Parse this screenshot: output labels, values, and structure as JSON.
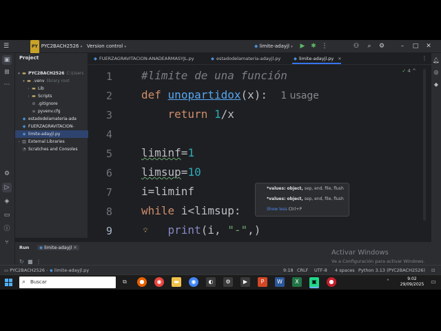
{
  "titlebar": {
    "project_badge": "PY",
    "project_name": "PYC2BACH2526",
    "vcs": "Version control",
    "run_config": "limite-adayjl"
  },
  "project_panel": {
    "title": "Project",
    "rows": [
      {
        "label": "PYC2BACH2526",
        "extra": "C:\\Users",
        "kind": "folder",
        "indent": 0,
        "expanded": true
      },
      {
        "label": ".venv",
        "extra": "library root",
        "kind": "folder",
        "indent": 1,
        "expanded": true
      },
      {
        "label": "Lib",
        "extra": "",
        "kind": "folder",
        "indent": 2,
        "expanded": false
      },
      {
        "label": "Scripts",
        "extra": "",
        "kind": "folder",
        "indent": 2,
        "expanded": false
      },
      {
        "label": ".gitignore",
        "extra": "",
        "kind": "file",
        "indent": 2
      },
      {
        "label": "pyvenv.cfg",
        "extra": "",
        "kind": "file",
        "indent": 2
      },
      {
        "label": "estadodelamateria-ada",
        "extra": "",
        "kind": "py",
        "indent": 1
      },
      {
        "label": "FUERZAGRAVITACION-",
        "extra": "",
        "kind": "py",
        "indent": 1
      },
      {
        "label": "limite-adayjl.py",
        "extra": "",
        "kind": "py",
        "indent": 1,
        "selected": true
      },
      {
        "label": "External Libraries",
        "extra": "",
        "kind": "lib",
        "indent": 0,
        "expanded": false
      },
      {
        "label": "Scratches and Consoles",
        "extra": "",
        "kind": "scratch",
        "indent": 0
      }
    ]
  },
  "tabs": [
    {
      "label": "FUERZAGRAVITACION-ANADEARMASYJL.py",
      "active": false
    },
    {
      "label": "estadodelamateria-adayjl.py",
      "active": false
    },
    {
      "label": "limite-adayjl.py",
      "active": true
    }
  ],
  "editor": {
    "inspections": "4",
    "line_numbers": [
      "1",
      "2",
      "3",
      "4",
      "5",
      "6",
      "7",
      "8",
      "9"
    ],
    "current_line": "9",
    "lines": {
      "l1": "#límite de una función",
      "l2_def": "def",
      "l2_fn": "unopartidox",
      "l2_args": "(x):",
      "l2_hint": "1 usage",
      "l3_kw": "return",
      "l3_num": "1",
      "l3_rest": "/x",
      "l5_a": "liminf",
      "l5_b": "=",
      "l5_num": "1",
      "l6_a": "limsup",
      "l6_b": "=",
      "l6_num": "10",
      "l7": "i=liminf",
      "l8_kw": "while",
      "l8_rest": " i<limsup:",
      "l9_fn": "print",
      "l9_a": "(i, ",
      "l9_str": "\"-\"",
      "l9_b": ",)"
    }
  },
  "param_popup": {
    "row1_bold": "*values: object,",
    "row1_rest": " sep, end, file, flush",
    "row2_bold": "*values: object,",
    "row2_rest": " sep, end, file, flush",
    "show_less": "Show less",
    "shortcut": "Ctrl+P"
  },
  "run_panel": {
    "title": "Run",
    "config": "limite-adayjl"
  },
  "statusbar": {
    "project": "PYC2BACH2526",
    "file": "limite-adayjl.py",
    "position": "9:18",
    "line_sep": "CRLF",
    "encoding": "UTF-8",
    "indent": "4 spaces",
    "interpreter": "Python 3.13 (PYC2BACH2526)"
  },
  "watermark": {
    "title": "Activar Windows",
    "subtitle": "Ve a Configuración para activar Windows."
  },
  "taskbar": {
    "search": "Buscar",
    "time": "9:02",
    "date": "29/09/2025"
  },
  "colors": {
    "keyword": "#cf8e6d",
    "function": "#56a8f5",
    "number": "#2aacb8",
    "string": "#6aab73",
    "comment": "#7a7e85",
    "accent": "#3574f0"
  }
}
